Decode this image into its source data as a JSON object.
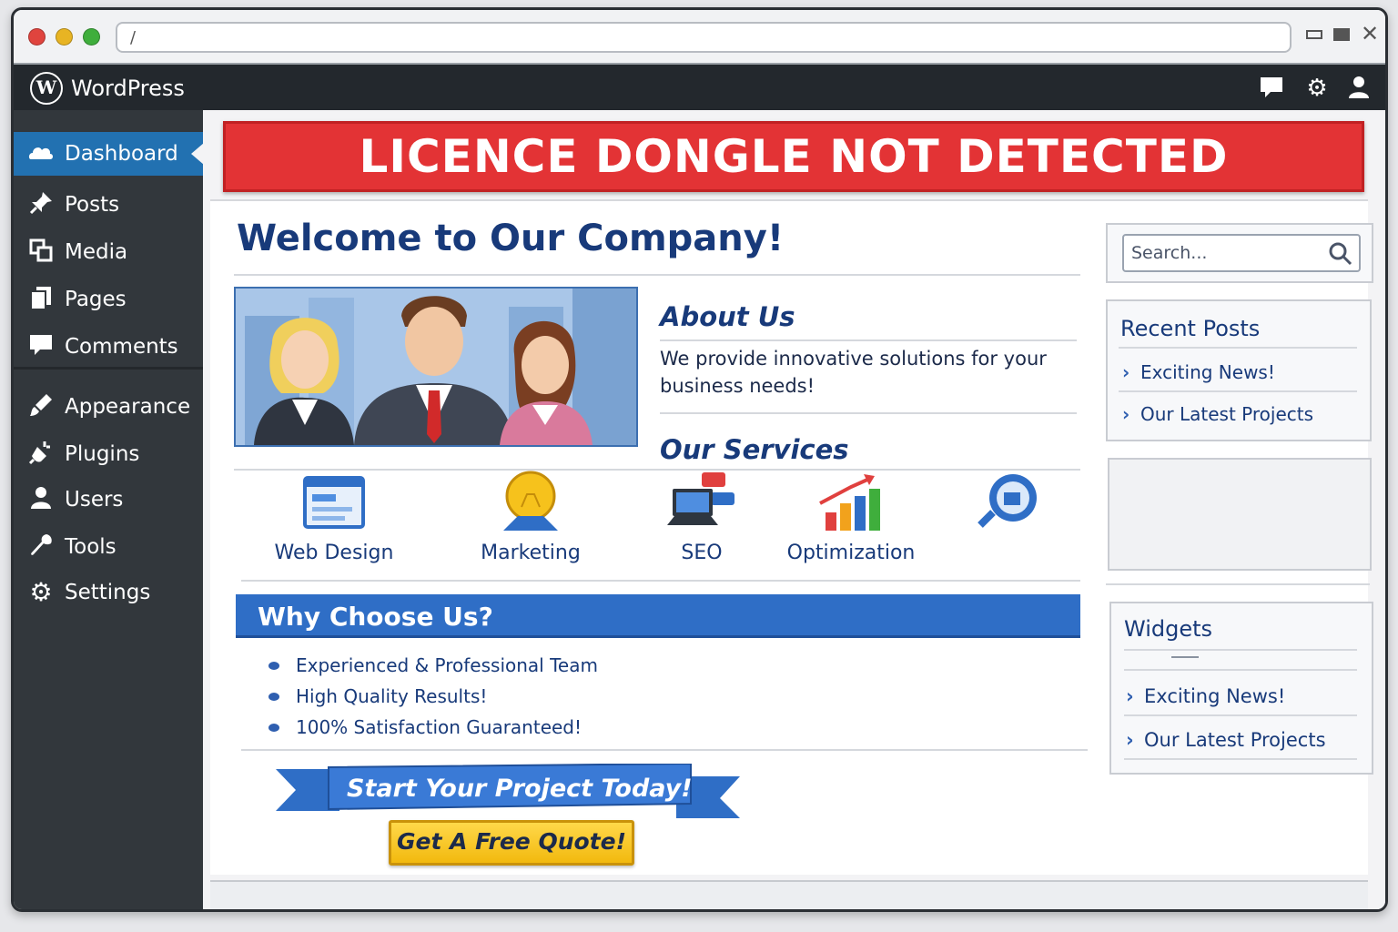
{
  "browser": {
    "url": "/"
  },
  "admin_bar": {
    "brand": "WordPress",
    "icons": [
      "comment-icon",
      "gear-icon",
      "user-icon"
    ]
  },
  "sidebar": {
    "items": [
      {
        "label": "Dashboard",
        "icon": "dashboard-icon",
        "active": true
      },
      {
        "label": "Posts",
        "icon": "pin-icon"
      },
      {
        "label": "Media",
        "icon": "media-icon"
      },
      {
        "label": "Pages",
        "icon": "pages-icon"
      },
      {
        "label": "Comments",
        "icon": "comment-icon"
      },
      {
        "label": "Appearance",
        "icon": "brush-icon"
      },
      {
        "label": "Plugins",
        "icon": "plug-icon"
      },
      {
        "label": "Users",
        "icon": "user-icon"
      },
      {
        "label": "Tools",
        "icon": "wrench-icon"
      },
      {
        "label": "Settings",
        "icon": "gear-icon"
      }
    ]
  },
  "alert": {
    "text": "LICENCE DONGLE NOT DETECTED",
    "color": "#e33335"
  },
  "main": {
    "welcome": "Welcome to Our Company!",
    "about_title": "About Us",
    "about_text": "We provide innovative solutions for your business needs!",
    "services_title": "Our Services",
    "services": [
      {
        "label": "Web Design",
        "icon": "web-design-icon"
      },
      {
        "label": "Marketing",
        "icon": "lightbulb-icon"
      },
      {
        "label": "SEO",
        "icon": "computer-icon"
      },
      {
        "label": "Optimization",
        "icon": "bar-chart-icon"
      },
      {
        "label": "",
        "icon": "magnifier-icon"
      }
    ],
    "why_title": "Why Choose Us?",
    "why_items": [
      "Experienced & Professional Team",
      "High Quality Results!",
      "100% Satisfaction Guaranteed!"
    ],
    "cta_ribbon": "Start Your Project Today!",
    "cta_button": "Get A Free Quote!"
  },
  "right": {
    "search_placeholder": "Search...",
    "recent_title": "Recent Posts",
    "recent_posts": [
      "Exciting News!",
      "Our Latest Projects"
    ],
    "widgets_title": "Widgets",
    "widget_links": [
      "Exciting News!",
      "Our Latest Projects"
    ]
  },
  "colors": {
    "admin_bar": "#23282d",
    "sidebar": "#32373c",
    "active": "#2271b1",
    "heading": "#183a7a",
    "banner": "#2f6ec6",
    "button": "#f2b90e"
  }
}
